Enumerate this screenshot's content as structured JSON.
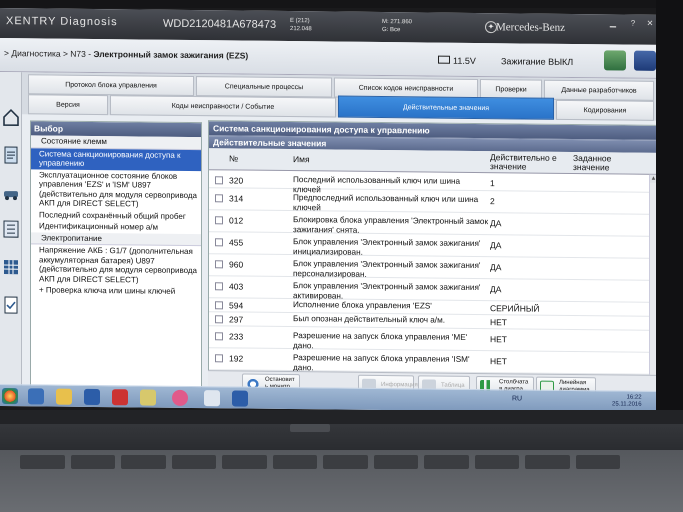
{
  "header": {
    "brand": "XENTRY Diagnosis",
    "vin": "WDD2120481A678473",
    "model_code": "E (212)",
    "model_num": "212.048",
    "odometer": "M: 271.860",
    "variant": "G: Все",
    "make": "Mercedes-Benz"
  },
  "crumb": {
    "path_prefix": "> Диагностика > N73 - ",
    "path_bold": "Электронный замок зажигания (EZS)",
    "battery": "11.5V",
    "ignition": "Зажигание ВЫКЛ"
  },
  "tabs": [
    {
      "label": "Протокол блока управления",
      "active": false
    },
    {
      "label": "Специальные процессы",
      "active": false
    },
    {
      "label": "Список кодов неисправности",
      "active": false
    },
    {
      "label": "Проверки",
      "active": false
    },
    {
      "label": "Данные разработчиков",
      "active": false
    },
    {
      "label": "Версия",
      "active": false
    },
    {
      "label": "Коды неисправности / Событие",
      "active": false
    },
    {
      "label": "Действительные значения",
      "active": true
    },
    {
      "label": "Кодирования",
      "active": false
    }
  ],
  "selection": {
    "title": "Выбор",
    "items": [
      {
        "label": "Состояние клемм",
        "type": "head"
      },
      {
        "label": "Система санкционирования доступа к управлению",
        "type": "selected"
      },
      {
        "label": "Эксплуатационное состояние блоков управления 'EZS' и 'ISM' U897 (действительно для модуля сервопривода АКП для DIRECT SELECT)",
        "type": "normal"
      },
      {
        "label": "Последний сохранённый общий пробег",
        "type": "normal"
      },
      {
        "label": "Идентификационный номер а/м",
        "type": "normal"
      },
      {
        "label": "Электропитание",
        "type": "head"
      },
      {
        "label": "Напряжение АКБ : G1/7 (дополнительная аккумуляторная батарея) U897 (действительно для модуля сервопривода АКП для DIRECT SELECT)",
        "type": "normal"
      },
      {
        "label": "Проверка ключа или шины ключей",
        "type": "plus"
      }
    ]
  },
  "content": {
    "title": "Система санкционирования доступа к управлению",
    "subtitle": "Действительные значения",
    "columns": {
      "num": "№",
      "name": "Имя",
      "actual": "Действительно е значение",
      "target": "Заданное значение"
    },
    "rows": [
      {
        "num": "320",
        "name": "Последний использованный ключ или шина ключей",
        "value": "1"
      },
      {
        "num": "314",
        "name": "Предпоследний использованный ключ или шина ключей",
        "value": "2"
      },
      {
        "num": "012",
        "name": "Блокировка блока управления 'Электронный замок зажигания' снята.",
        "value": "ДА"
      },
      {
        "num": "455",
        "name": "Блок управления 'Электронный замок зажигания' инициализирован.",
        "value": "ДА"
      },
      {
        "num": "960",
        "name": "Блок управления 'Электронный замок зажигания' персонализирован.",
        "value": "ДА"
      },
      {
        "num": "403",
        "name": "Блок управления 'Электронный замок зажигания' активирован.",
        "value": "ДА"
      },
      {
        "num": "594",
        "name": "Исполнение блока управления 'EZS'",
        "value": "СЕРИЙНЫЙ"
      },
      {
        "num": "297",
        "name": "Был опознан действительный ключ а/м.",
        "value": "НЕТ"
      },
      {
        "num": "233",
        "name": "Разрешение на запуск блока управления 'ME' дано.",
        "value": "НЕТ"
      },
      {
        "num": "192",
        "name": "Разрешение на запуск блока управления 'ISM' дано.",
        "value": "НЕТ"
      }
    ]
  },
  "buttons": {
    "stop": "Остановит ь монито...",
    "info": "Информация",
    "table": "Таблица",
    "bar": "Столбчата я диагра...",
    "line": "Линейная диаграмма"
  },
  "taskbar": {
    "tray": "RU",
    "time": "16:22",
    "date": "25.11.2016"
  }
}
